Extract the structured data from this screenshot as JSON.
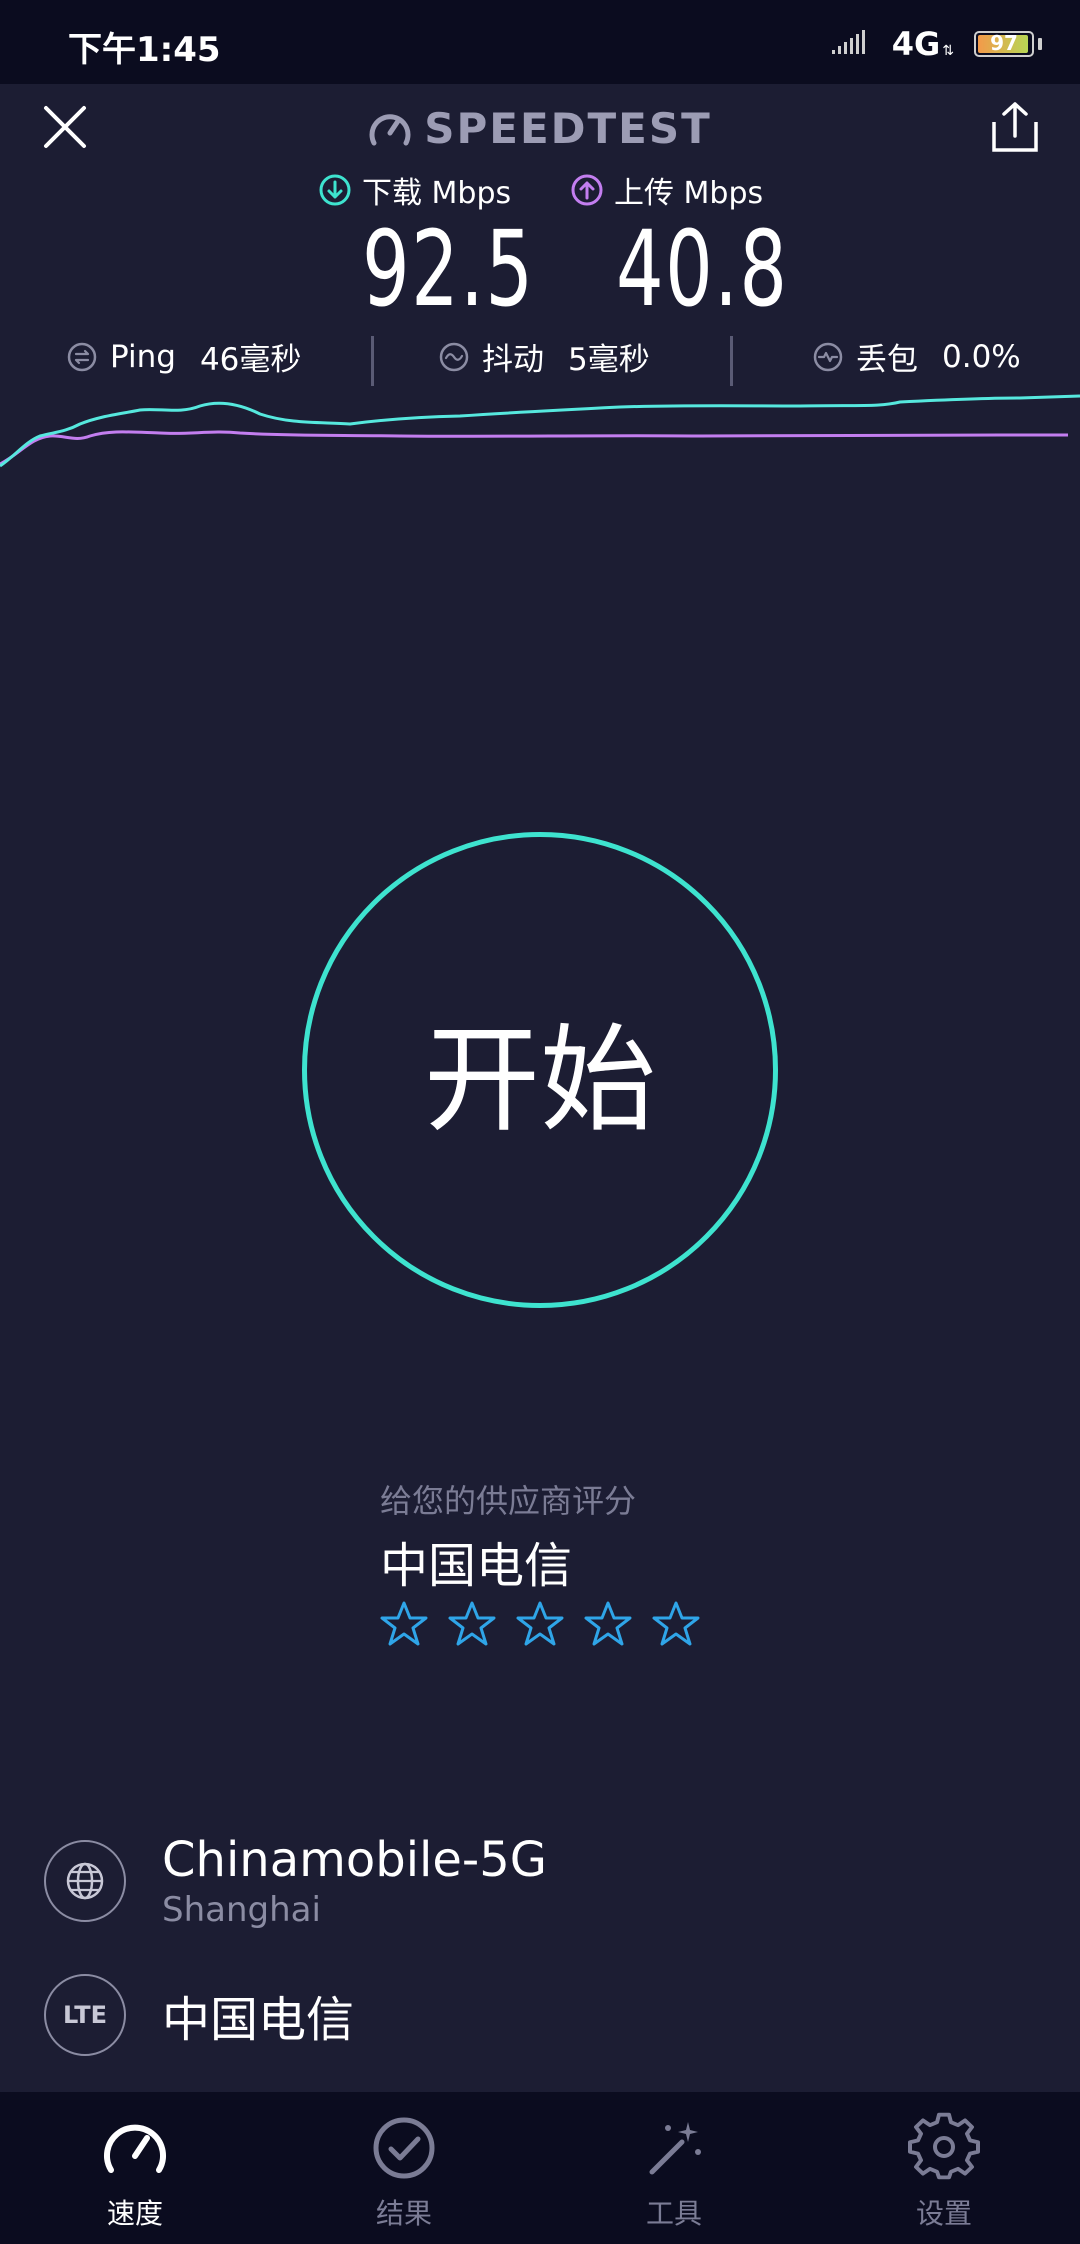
{
  "status_bar": {
    "time": "下午1:45",
    "network": "4G",
    "battery": "97"
  },
  "header": {
    "title": "SPEEDTEST"
  },
  "download": {
    "label": "下载 Mbps",
    "value": "92.5",
    "color": "#3ee3cf"
  },
  "upload": {
    "label": "上传 Mbps",
    "value": "40.8",
    "color": "#c37ef0"
  },
  "stats": {
    "ping_label": "Ping",
    "ping_value": "46毫秒",
    "jitter_label": "抖动",
    "jitter_value": "5毫秒",
    "loss_label": "丢包",
    "loss_value": "0.0%"
  },
  "start_button": {
    "label": "开始",
    "color": "#3ee3cf"
  },
  "rating": {
    "prompt": "给您的供应商评分",
    "provider": "中国电信",
    "stars": 5,
    "star_color": "#2fa5e8"
  },
  "server": {
    "name": "Chinamobile-5G",
    "location": "Shanghai",
    "icon": "globe-icon"
  },
  "carrier": {
    "icon_text": "LTE",
    "name": "中国电信"
  },
  "nav": {
    "items": [
      {
        "label": "速度",
        "icon": "speedometer-icon",
        "active": true
      },
      {
        "label": "结果",
        "icon": "check-circle-icon",
        "active": false
      },
      {
        "label": "工具",
        "icon": "magic-wand-icon",
        "active": false
      },
      {
        "label": "设置",
        "icon": "gear-icon",
        "active": false
      }
    ]
  }
}
